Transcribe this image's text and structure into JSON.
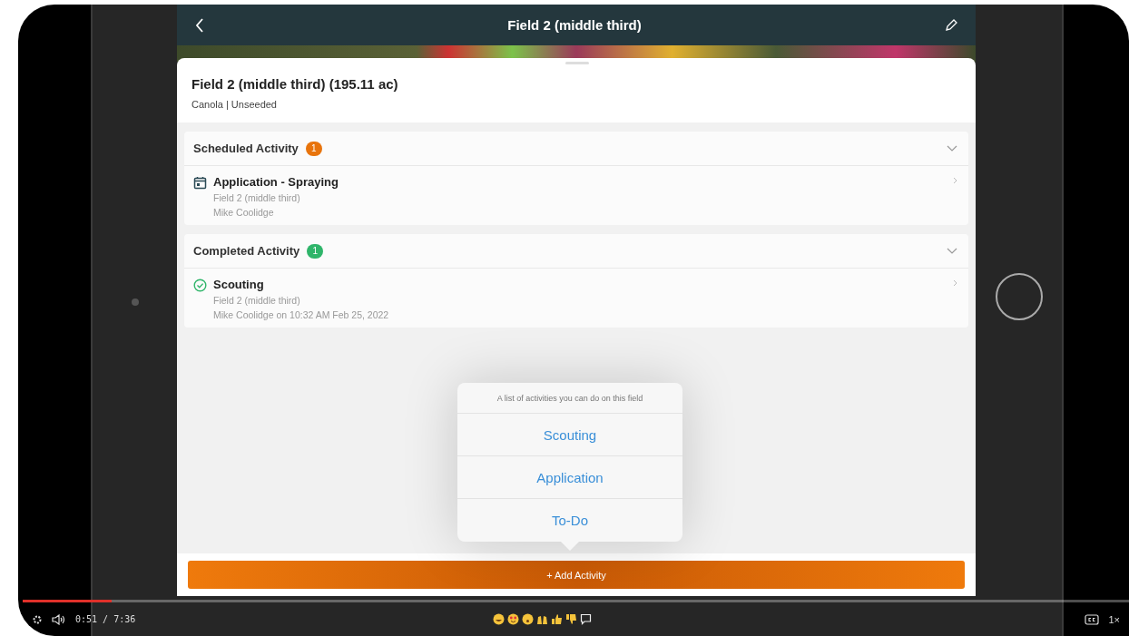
{
  "app": {
    "title": "Field 2 (middle third)"
  },
  "field": {
    "name": "Field 2 (middle third) (195.11 ac)",
    "subtitle": "Canola | Unseeded"
  },
  "sections": [
    {
      "title": "Scheduled Activity",
      "count": "1",
      "color": "#e8740c",
      "items": [
        {
          "kind": "scheduled",
          "title": "Application - Spraying",
          "lines": [
            "Field 2 (middle third)",
            "Mike Coolidge"
          ]
        }
      ]
    },
    {
      "title": "Completed Activity",
      "count": "1",
      "color": "#2fb56a",
      "items": [
        {
          "kind": "completed",
          "title": "Scouting",
          "lines": [
            "Field 2 (middle third)",
            "Mike Coolidge on 10:32 AM Feb 25, 2022"
          ]
        }
      ]
    }
  ],
  "menu": {
    "header": "A list of activities you can do on this field",
    "options": [
      "Scouting",
      "Application",
      "To-Do"
    ]
  },
  "add_button": "+ Add Activity",
  "video": {
    "progress": {
      "level": 0.08
    },
    "time": "0:51 / 7:36",
    "speed": "1×"
  }
}
